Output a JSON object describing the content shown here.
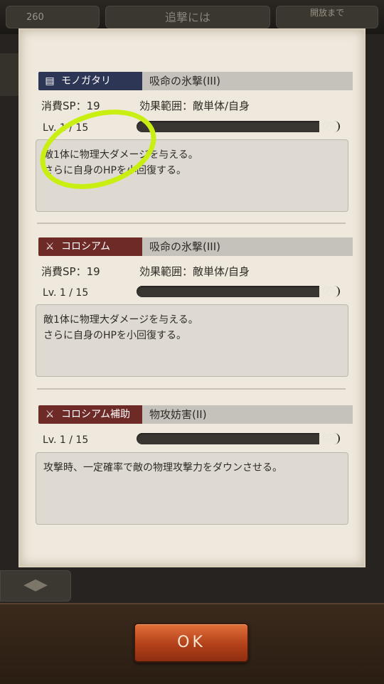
{
  "background": {
    "top_left_value": "260",
    "top_center_text": "追撃には",
    "top_right_text": "開放まで",
    "nav_arrows": "◀▶"
  },
  "skills": [
    {
      "category": "モノガタリ",
      "category_icon": "book-icon",
      "category_color": "#2e3656",
      "name": "吸命の氷撃(III)",
      "sp": "消費SP：19",
      "range": "効果範囲：敵単体/自身",
      "level": "Lv. 1 / 15",
      "progress": "0%",
      "progress_value": 0,
      "description": [
        "敵1体に物理大ダメージを与える。",
        "さらに自身のHPを小回復する。"
      ]
    },
    {
      "category": "コロシアム",
      "category_icon": "crossed-swords-icon",
      "category_color": "#6e2a26",
      "name": "吸命の氷撃(III)",
      "sp": "消費SP：19",
      "range": "効果範囲：敵単体/自身",
      "level": "Lv. 1 / 15",
      "progress": "0%",
      "progress_value": 0,
      "description": [
        "敵1体に物理大ダメージを与える。",
        "さらに自身のHPを小回復する。"
      ]
    },
    {
      "category": "コロシアム補助",
      "category_icon": "crossed-swords-support-icon",
      "category_color": "#6e2a26",
      "name": "物攻妨害(II)",
      "level": "Lv. 1 / 15",
      "progress": "0%",
      "progress_value": 0,
      "description": [
        "攻撃時、一定確率で敵の物理攻撃力をダウンさせる。"
      ]
    }
  ],
  "ok_button": "OK",
  "annotation_color": "#c9ef12"
}
